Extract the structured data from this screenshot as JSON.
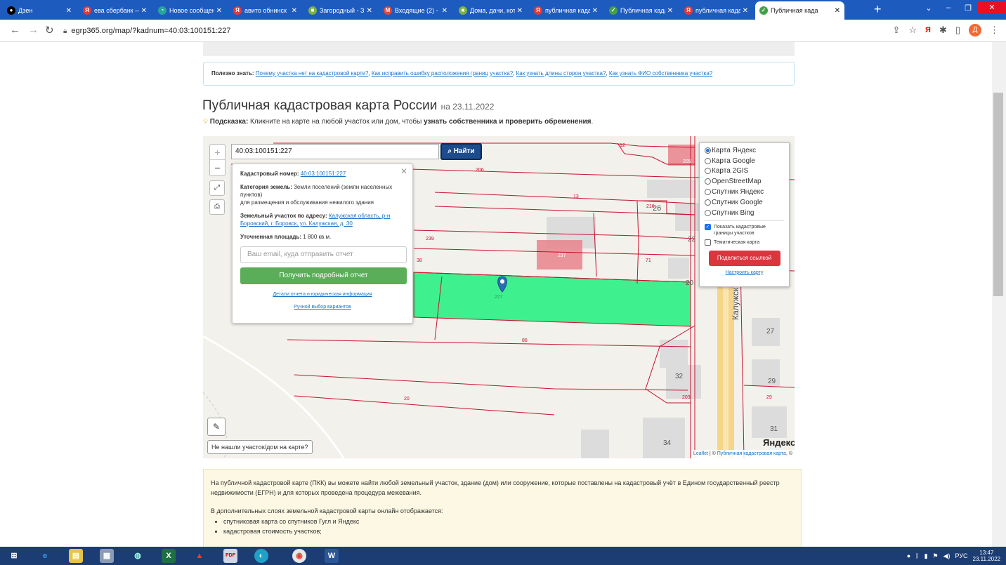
{
  "browser": {
    "tabs": [
      {
        "title": "Дзен",
        "icon": "dzen-icon",
        "color": "#000000",
        "glyph": "●"
      },
      {
        "title": "ева сбербанк —",
        "icon": "yandex-icon",
        "color": "#e53935",
        "glyph": "Я"
      },
      {
        "title": "Новое сообщен",
        "icon": "message-icon",
        "color": "#26a69a",
        "glyph": "◔"
      },
      {
        "title": "авито обнинск",
        "icon": "yandex-icon",
        "color": "#e53935",
        "glyph": "Я"
      },
      {
        "title": "Загородный - З",
        "icon": "realty-icon",
        "color": "#7cb342",
        "glyph": "■"
      },
      {
        "title": "Входящие (2) -",
        "icon": "gmail-icon",
        "color": "#ea4335",
        "glyph": "M"
      },
      {
        "title": "Дома, дачи, кот",
        "icon": "realty-icon",
        "color": "#7cb342",
        "glyph": "■"
      },
      {
        "title": "публичная када",
        "icon": "yandex-icon",
        "color": "#e53935",
        "glyph": "Я"
      },
      {
        "title": "Публичная када",
        "icon": "check-icon",
        "color": "#43a047",
        "glyph": "✓"
      },
      {
        "title": "публичная када",
        "icon": "yandex-icon",
        "color": "#e53935",
        "glyph": "Я"
      },
      {
        "title": "Публичная када",
        "icon": "check-icon",
        "color": "#43a047",
        "glyph": "✓"
      }
    ],
    "url": "egrp365.org/map/?kadnum=40:03:100151:227",
    "profile_letter": "Д",
    "yandex_letter": "Я"
  },
  "useful": {
    "label": "Полезно знать:",
    "links": [
      "Почему участка нет на кадастровой карте?",
      "Как исправить ошибку расположения границ участка?",
      "Как узнать длины сторон участка?",
      "Как узнать ФИО собственника участка?"
    ]
  },
  "header": {
    "title": "Публичная кадастровая карта России",
    "date": "на 23.11.2022",
    "hint_label": "Подсказка:",
    "hint_text": " Кликните на карте на любой участок или дом, чтобы ",
    "hint_bold": "узнать собственника и проверить обременения",
    "hint_end": "."
  },
  "map": {
    "search_value": "40:03:100151:227",
    "find_label": "Найти",
    "zoom_in": "+",
    "zoom_out": "−",
    "popup": {
      "cadnum_label": "Кадастровый номер:",
      "cadnum_value": "40:03:100151:227",
      "category_label": "Категория земель:",
      "category_value": "Земли поселений (земли населенных пунктов)",
      "category_use": "для размещения и обслуживания нежилого здания",
      "address_label": "Земельный участок по адресу:",
      "address_value": "Калужская область, р-н Боровский, г. Боровск, ул. Калужская, д. 30",
      "area_label": "Уточненная площадь:",
      "area_value": "1 800 кв.м.",
      "email_placeholder": "Ваш email, куда отправить отчет",
      "report_button": "Получить подробный отчет",
      "details_link": "Детали отчета и юридическая информация",
      "manual_link": "Ручной выбор вариантов"
    },
    "layers": {
      "options": [
        "Карта Яндекс",
        "Карта Google",
        "Карта 2GIS",
        "OpenStreetMap",
        "Спутник Яндекс",
        "Спутник Google",
        "Спутник Bing"
      ],
      "selected": "Карта Яндекс",
      "show_borders": "Показать кадастровые границы участков",
      "thematic": "Тематическая карта",
      "share_button": "Поделиться ссылкой",
      "tune_link": "Настроить карту"
    },
    "parcel_labels": [
      "12",
      "206",
      "205",
      "13",
      "216",
      "26",
      "239",
      "22",
      "237",
      "71",
      "38",
      "86",
      "27",
      "32",
      "29",
      "203",
      "29",
      "20",
      "31",
      "34",
      "20",
      "227"
    ],
    "street_label": "Калужская",
    "not_found": "Не нашли участок/дом на карте?",
    "yandex_logo": "Яндекс",
    "attribution_leaflet": "Leaflet",
    "attribution_sep": " | © ",
    "attribution_pkk": "Публичная кадастровая карта",
    "attribution_end": ", ©",
    "colors": {
      "selected_parcel": "#3ef08e",
      "highlight": "#e8848c",
      "border": "#c8102e"
    }
  },
  "info": {
    "para1": "На публичной кадастровой карте (ПКК) вы можете найти любой земельный участок, здание (дом) или сооружение, которые поставлены на кадастровый учёт в Едином государственный реестр недвижимости (ЕГРН) и для которых проведена процедура межевания.",
    "para2": "В дополнительных слоях земельной кадастровой карты онлайн отображается:",
    "items": [
      "спутниковая карта со спутников Гугл и Яндекс",
      "кадастровая стоимость участков;"
    ]
  },
  "taskbar": {
    "lang": "РУС",
    "time": "13:47",
    "date": "23.11.2022"
  }
}
